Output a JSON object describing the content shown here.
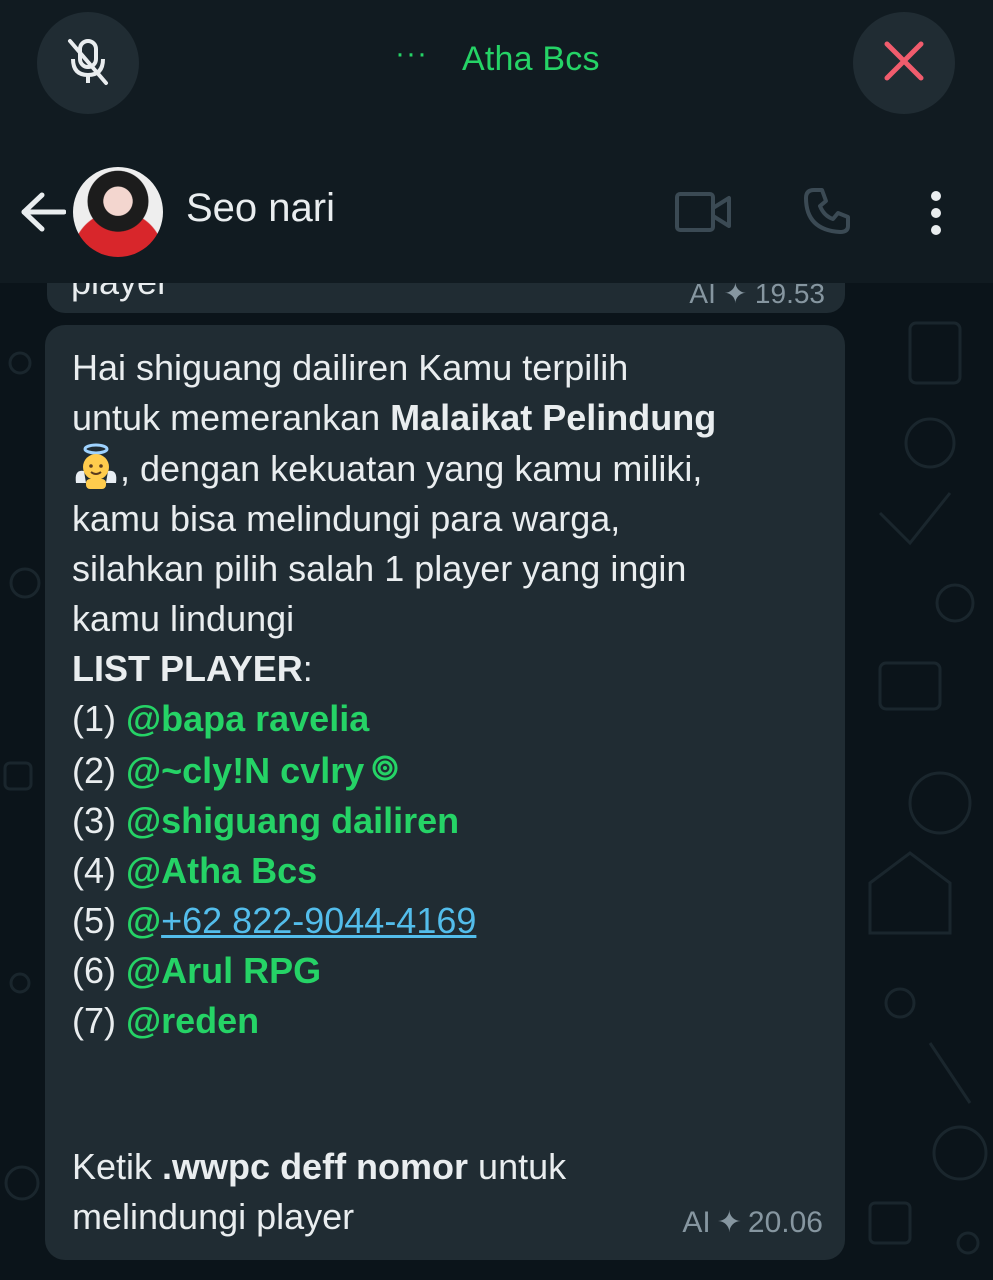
{
  "call": {
    "name": "Atha Bcs",
    "dots": "···"
  },
  "header": {
    "contact_name": "Seo nari"
  },
  "previous_message": {
    "text": "player",
    "ai_label": "AI",
    "time": "19.53"
  },
  "message": {
    "line1": "Hai shiguang dailiren Kamu terpilih",
    "line2_prefix": "untuk memerankan ",
    "line2_bold": "Malaikat Pelindung",
    "line3_rest": ", dengan kekuatan yang kamu miliki,",
    "line4": "kamu bisa melindungi para warga,",
    "line5": "silahkan pilih salah 1 player yang ingin",
    "line6": "kamu lindungi",
    "list_header": "LIST PLAYER",
    "list_header_suffix": ":",
    "players": [
      {
        "num": "(1) ",
        "mention": "@bapa ravelia"
      },
      {
        "num": "(2) ",
        "mention": "@~cly!N cvlry"
      },
      {
        "num": "(3) ",
        "mention": "@shiguang dailiren"
      },
      {
        "num": "(4) ",
        "mention": "@Atha Bcs"
      },
      {
        "num": "(5) ",
        "mention_at": "@",
        "phone": "+62 822-9044-4169"
      },
      {
        "num": "(6) ",
        "mention": "@Arul RPG"
      },
      {
        "num": "(7) ",
        "mention": "@reden"
      }
    ],
    "footer_prefix": "Ketik ",
    "footer_bold": ".wwpc deff nomor",
    "footer_suffix": " untuk",
    "footer_line2": "melindungi player",
    "ai_label": "AI",
    "time": "20.06"
  },
  "colors": {
    "accent_green": "#25d366",
    "end_call_red": "#f15c6d",
    "link_blue": "#53bdeb",
    "bubble_bg": "#202c33"
  }
}
